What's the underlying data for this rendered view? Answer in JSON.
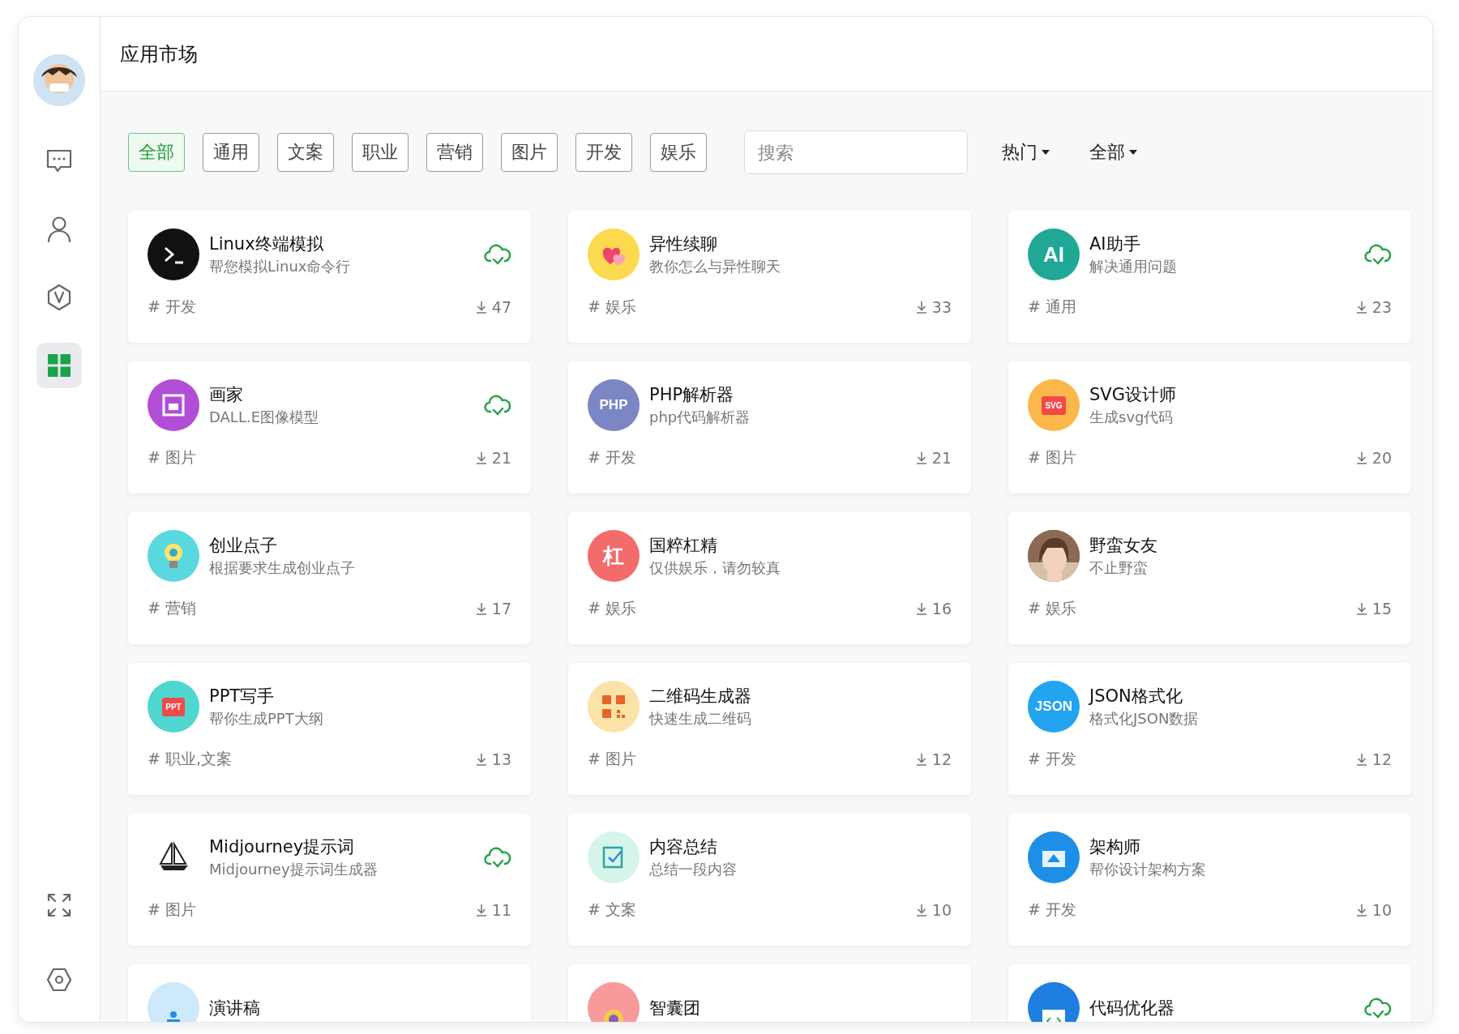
{
  "sidebar": {
    "items": [
      {
        "kind": "chat",
        "selected": false
      },
      {
        "kind": "user",
        "selected": false
      },
      {
        "kind": "version",
        "selected": false
      },
      {
        "kind": "apps",
        "selected": true
      }
    ],
    "bottom": [
      {
        "kind": "expand"
      },
      {
        "kind": "settings"
      }
    ]
  },
  "header": {
    "title": "应用市场"
  },
  "filters": [
    {
      "label": "全部",
      "selected": true
    },
    {
      "label": "通用",
      "selected": false
    },
    {
      "label": "文案",
      "selected": false
    },
    {
      "label": "职业",
      "selected": false
    },
    {
      "label": "营销",
      "selected": false
    },
    {
      "label": "图片",
      "selected": false
    },
    {
      "label": "开发",
      "selected": false
    },
    {
      "label": "娱乐",
      "selected": false
    }
  ],
  "search": {
    "placeholder": "搜索"
  },
  "sort_dropdowns": [
    {
      "label": "热门"
    },
    {
      "label": "全部"
    }
  ],
  "apps": [
    {
      "name": "Linux终端模拟",
      "description": "帮您模拟Linux命令行",
      "tag": "# 开发",
      "downloads": "47",
      "installed": true,
      "avatar": {
        "kind": "terminal",
        "color": "#111111"
      }
    },
    {
      "name": "异性续聊",
      "description": "教你怎么与异性聊天",
      "tag": "# 娱乐",
      "downloads": "33",
      "installed": false,
      "avatar": {
        "kind": "hearts",
        "color": "#fcd94f"
      }
    },
    {
      "name": "AI助手",
      "description": "解决通用问题",
      "tag": "# 通用",
      "downloads": "23",
      "installed": true,
      "avatar": {
        "kind": "text",
        "text": "AI",
        "color": "#1fa896"
      }
    },
    {
      "name": "画家",
      "description": "DALL.E图像模型",
      "tag": "# 图片",
      "downloads": "21",
      "installed": true,
      "avatar": {
        "kind": "frame",
        "color": "#b04fd6"
      }
    },
    {
      "name": "PHP解析器",
      "description": "php代码解析器",
      "tag": "# 开发",
      "downloads": "21",
      "installed": false,
      "avatar": {
        "kind": "text",
        "text": "PHP",
        "color": "#7b86c4"
      }
    },
    {
      "name": "SVG设计师",
      "description": "生成svg代码",
      "tag": "# 图片",
      "downloads": "20",
      "installed": false,
      "avatar": {
        "kind": "file",
        "text": "SVG",
        "color": "#fbb74a"
      }
    },
    {
      "name": "创业点子",
      "description": "根据要求生成创业点子",
      "tag": "# 营销",
      "downloads": "17",
      "installed": false,
      "avatar": {
        "kind": "bulb",
        "color": "#5ad8df"
      }
    },
    {
      "name": "国粹杠精",
      "description": "仅供娱乐，请勿较真",
      "tag": "# 娱乐",
      "downloads": "16",
      "installed": false,
      "avatar": {
        "kind": "text",
        "text": "杠",
        "color": "#f46b6b"
      }
    },
    {
      "name": "野蛮女友",
      "description": "不止野蛮",
      "tag": "# 娱乐",
      "downloads": "15",
      "installed": false
    },
    {
      "name": "PPT写手",
      "description": "帮你生成PPT大纲",
      "tag": "# 职业,文案",
      "downloads": "13",
      "installed": false,
      "avatar": {
        "kind": "file",
        "text": "PPT",
        "color": "#4fd6d0"
      }
    },
    {
      "name": "二维码生成器",
      "description": "快速生成二维码",
      "tag": "# 图片",
      "downloads": "12",
      "installed": false,
      "avatar": {
        "kind": "qr",
        "color": "#fbe3a8"
      }
    },
    {
      "name": "JSON格式化",
      "description": "格式化JSON数据",
      "tag": "# 开发",
      "downloads": "12",
      "installed": false,
      "avatar": {
        "kind": "text",
        "text": "JSON",
        "color": "#23a4f0"
      }
    },
    {
      "name": "Midjourney提示词",
      "description": "Midjourney提示词生成器",
      "tag": "# 图片",
      "downloads": "11",
      "installed": true,
      "avatar": {
        "kind": "ship",
        "color": "#ffffff"
      }
    },
    {
      "name": "内容总结",
      "description": "总结一段内容",
      "tag": "# 文案",
      "downloads": "10",
      "installed": false,
      "avatar": {
        "kind": "note",
        "color": "#d6f5ea"
      }
    },
    {
      "name": "架构师",
      "description": "帮你设计架构方案",
      "tag": "# 开发",
      "downloads": "10",
      "installed": false,
      "avatar": {
        "kind": "architect",
        "color": "#1e8fe6"
      }
    },
    {
      "name": "演讲稿",
      "installed": false,
      "avatar": {
        "kind": "speaker",
        "color": "#cde9fb"
      }
    },
    {
      "name": "智囊团",
      "installed": false,
      "avatar": {
        "kind": "sun",
        "color": "#f89a9a"
      }
    },
    {
      "name": "代码优化器",
      "installed": true,
      "avatar": {
        "kind": "code",
        "color": "#1f7fe0"
      }
    }
  ]
}
